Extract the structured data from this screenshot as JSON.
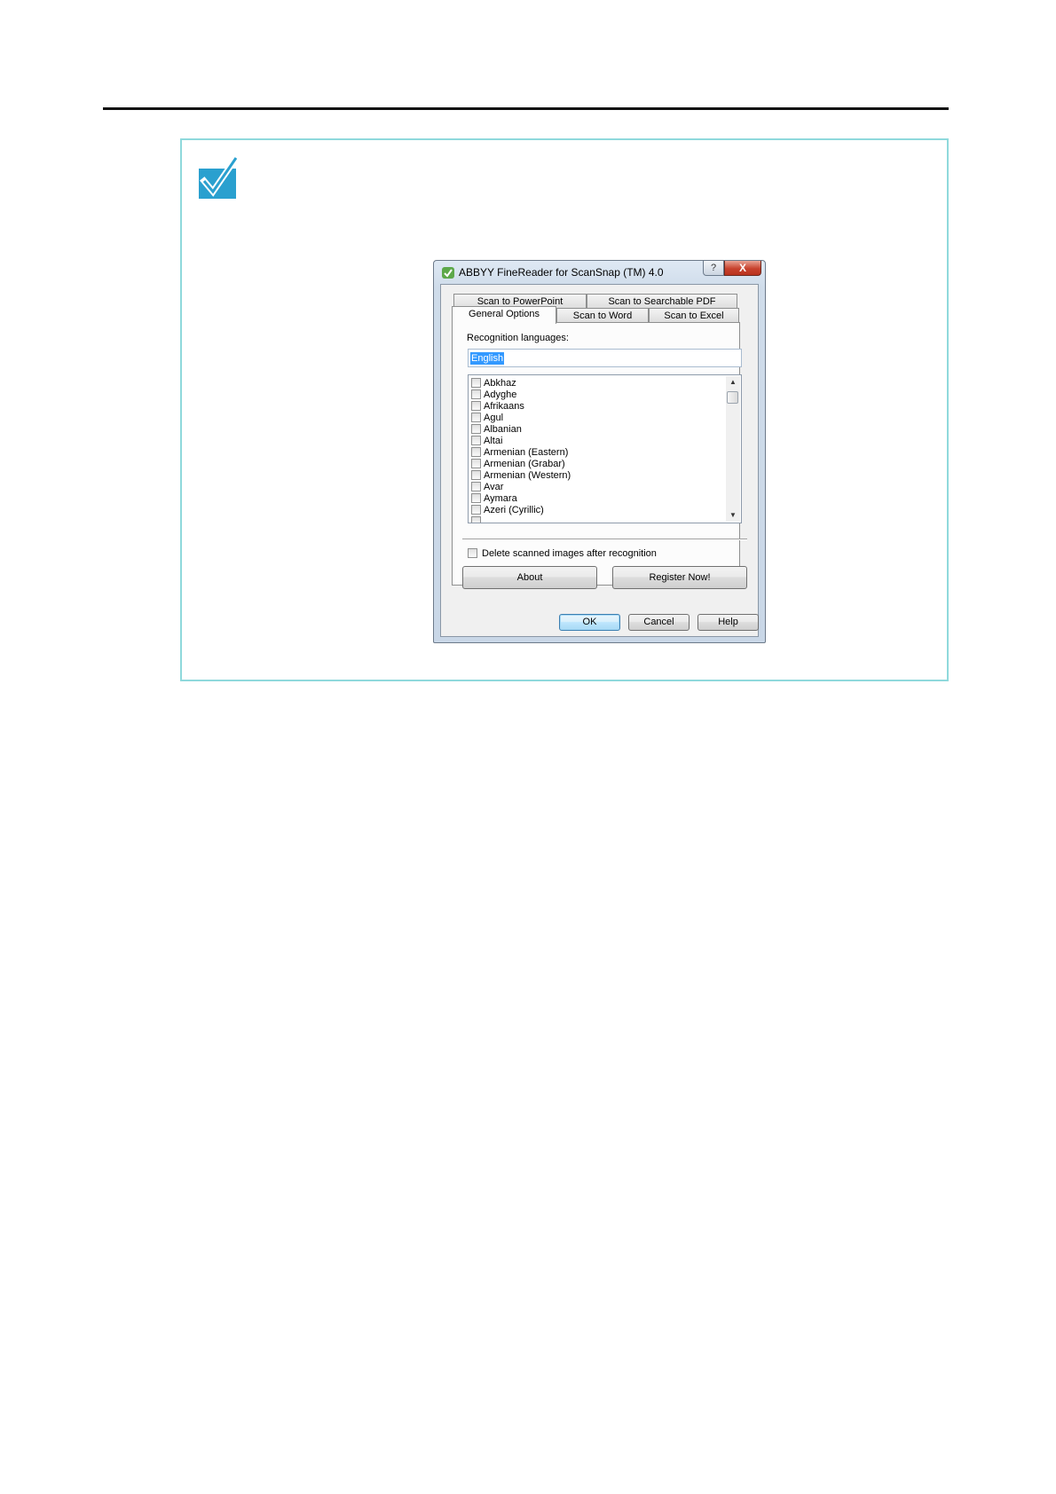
{
  "dialog": {
    "title": "ABBYY FineReader for ScanSnap (TM) 4.0",
    "help_button": "?",
    "close_button": "X",
    "tabs": [
      {
        "label": "Scan to PowerPoint"
      },
      {
        "label": "Scan to Searchable PDF"
      },
      {
        "label": "General Options"
      },
      {
        "label": "Scan to Word"
      },
      {
        "label": "Scan to Excel"
      }
    ],
    "active_tab": "General Options",
    "recognition_label": "Recognition languages:",
    "recognition_value": "English",
    "languages": [
      {
        "label": "Abkhaz",
        "checked": false
      },
      {
        "label": "Adyghe",
        "checked": false
      },
      {
        "label": "Afrikaans",
        "checked": false
      },
      {
        "label": "Agul",
        "checked": false
      },
      {
        "label": "Albanian",
        "checked": false
      },
      {
        "label": "Altai",
        "checked": false
      },
      {
        "label": "Armenian (Eastern)",
        "checked": false
      },
      {
        "label": "Armenian (Grabar)",
        "checked": false
      },
      {
        "label": "Armenian (Western)",
        "checked": false
      },
      {
        "label": "Avar",
        "checked": false
      },
      {
        "label": "Aymara",
        "checked": false
      },
      {
        "label": "Azeri (Cyrillic)",
        "checked": false
      }
    ],
    "delete_label": "Delete scanned images after recognition",
    "delete_checked": false,
    "about_label": "About",
    "register_label": "Register Now!",
    "ok_label": "OK",
    "cancel_label": "Cancel",
    "help_label": "Help"
  },
  "colors": {
    "note_border": "#8fd9dc",
    "note_icon": "#2aa0cf",
    "selection": "#3399ff"
  }
}
